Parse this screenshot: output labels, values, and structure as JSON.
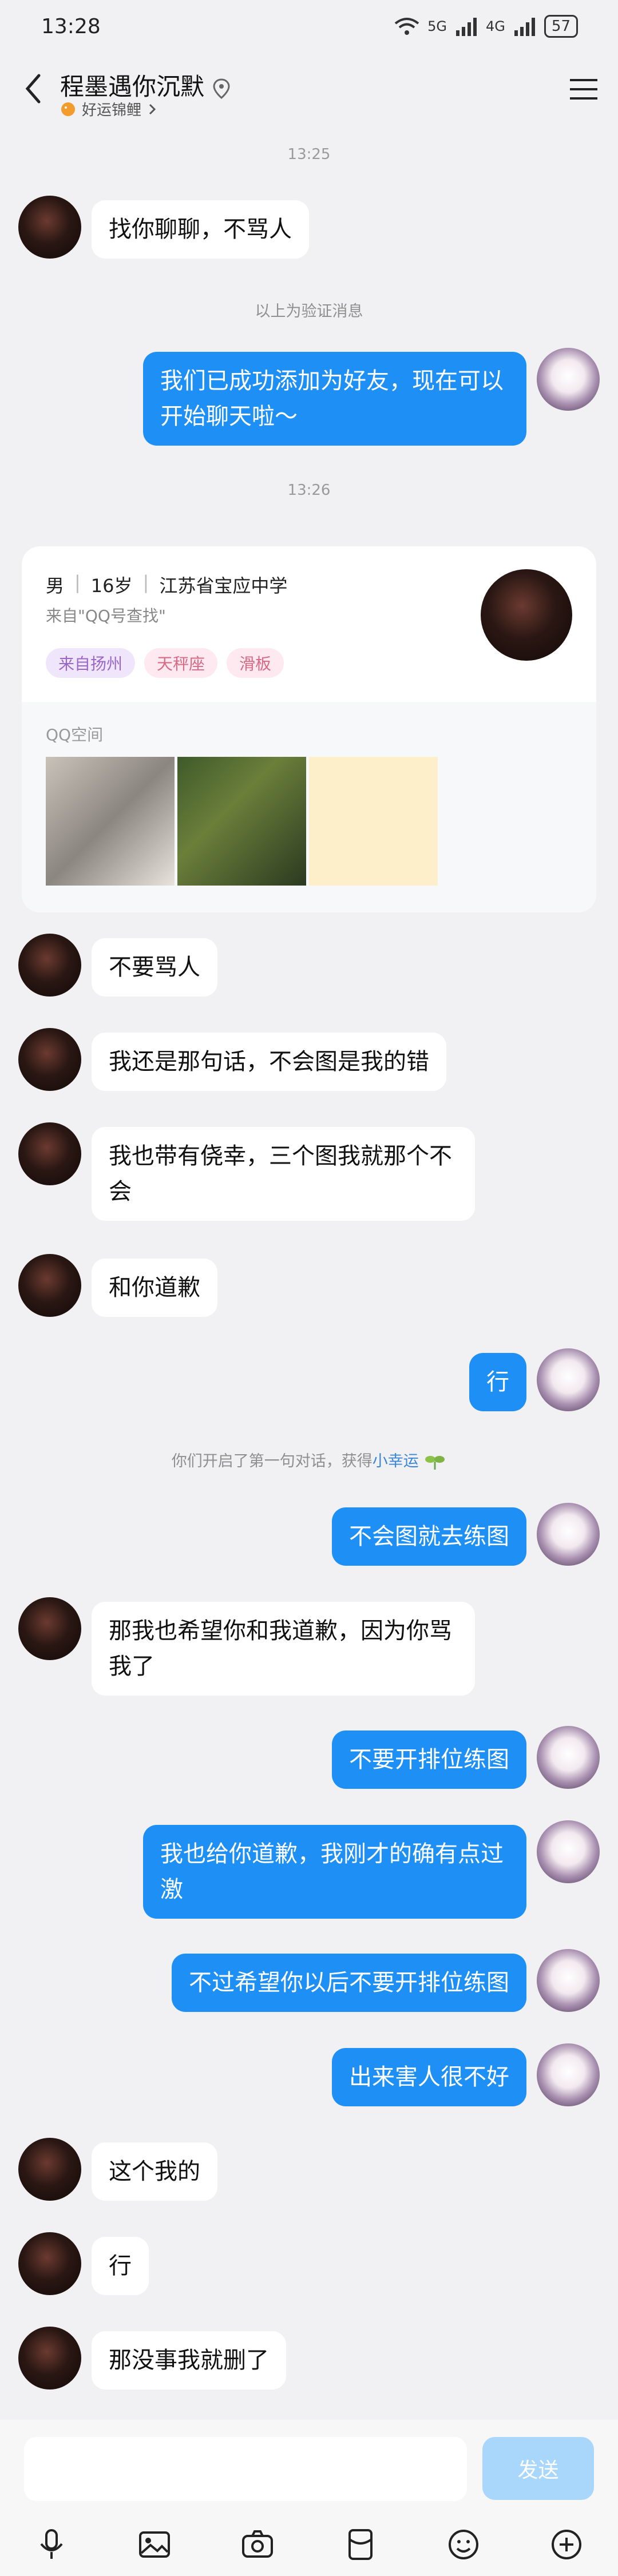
{
  "status": {
    "time": "13:28",
    "net1": "5G",
    "net2": "4G",
    "battery": "57"
  },
  "header": {
    "title": "程墨遇你沉默",
    "subtitle": "好运锦鲤"
  },
  "timestamps": [
    "13:25",
    "13:26"
  ],
  "system": {
    "verify": "以上为验证消息",
    "first_prefix": "你们开启了第一句对话，获得",
    "first_link": "小幸运"
  },
  "messages": {
    "m1": "找你聊聊，不骂人",
    "m2": "我们已成功添加为好友，现在可以开始聊天啦～",
    "m3": "不要骂人",
    "m4": "我还是那句话，不会图是我的错",
    "m5": "我也带有侥幸，三个图我就那个不会",
    "m6": "和你道歉",
    "m7": "行",
    "m8": "不会图就去练图",
    "m9": "那我也希望你和我道歉，因为你骂我了",
    "m10": "不要开排位练图",
    "m11": "我也给你道歉，我刚才的确有点过激",
    "m12": "不过希望你以后不要开排位练图",
    "m13": "出来害人很不好",
    "m14": "这个我的",
    "m15": "行",
    "m16": "那没事我就删了"
  },
  "profile": {
    "gender": "男",
    "age": "16岁",
    "school": "江苏省宝应中学",
    "source": "来自\"QQ号查找\"",
    "tags": [
      "来自扬州",
      "天秤座",
      "滑板"
    ],
    "qzone_label": "QQ空间"
  },
  "input": {
    "placeholder": "",
    "send_label": "发送"
  },
  "colors": {
    "accent": "#1e90f5",
    "bg": "#f1f1f3"
  }
}
